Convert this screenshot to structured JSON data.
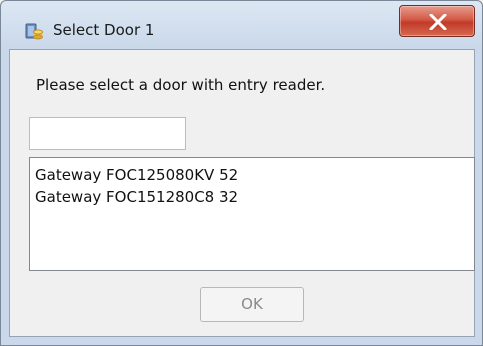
{
  "window": {
    "title": "Select Door 1",
    "title_icon": "door-database-icon",
    "close_icon": "close-icon"
  },
  "dialog": {
    "prompt": "Please select a door with entry reader.",
    "search": {
      "value": "",
      "placeholder": ""
    },
    "doors": [
      "Gateway FOC125080KV 52",
      "Gateway FOC151280C8 32"
    ],
    "ok_label": "OK",
    "ok_enabled": false
  },
  "colors": {
    "close_button": "#c84a36",
    "titlebar": "#c9d8ea",
    "client_background": "#f0f0f0",
    "disabled_text": "#8a8a8a"
  }
}
